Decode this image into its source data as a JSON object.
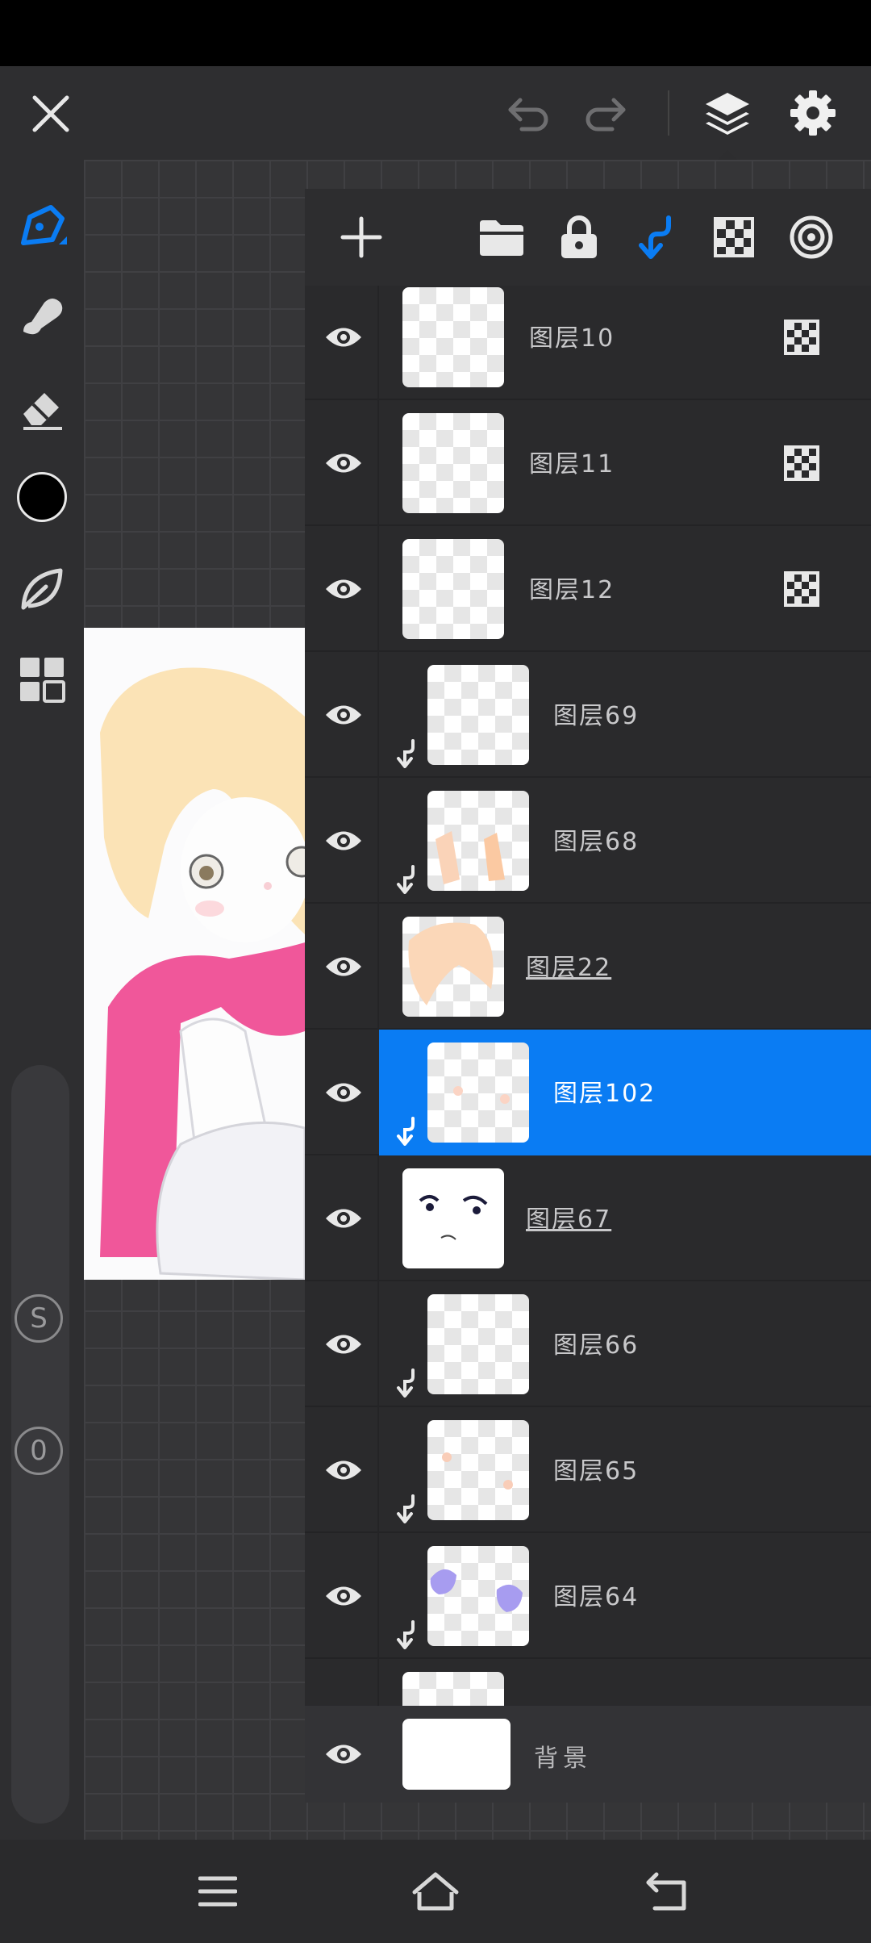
{
  "colors": {
    "accent": "#0a7cf3",
    "current_color": "#000000",
    "panel_bg": "#2a2a2c"
  },
  "topbar": {
    "close_icon": "close-icon",
    "undo_icon": "undo-icon",
    "redo_icon": "redo-icon",
    "layers_icon": "layers-icon",
    "settings_icon": "gear-icon"
  },
  "toolbar": {
    "tools": [
      "brush-tool",
      "smudge-tool",
      "eraser-tool",
      "color-swatch",
      "leaf-tool",
      "grid-tool"
    ],
    "size_label": "S",
    "opacity_label": "0"
  },
  "layer_panel": {
    "header_icons": [
      "add-layer-icon",
      "folder-icon",
      "lock-icon",
      "clip-icon",
      "alpha-lock-icon",
      "blend-icon"
    ],
    "layers": [
      {
        "name": "图层10",
        "clipped": false,
        "alpha_locked": true,
        "underlined": false,
        "selected": false
      },
      {
        "name": "图层11",
        "clipped": false,
        "alpha_locked": true,
        "underlined": false,
        "selected": false
      },
      {
        "name": "图层12",
        "clipped": false,
        "alpha_locked": true,
        "underlined": false,
        "selected": false
      },
      {
        "name": "图层69",
        "clipped": true,
        "alpha_locked": false,
        "underlined": false,
        "selected": false
      },
      {
        "name": "图层68",
        "clipped": true,
        "alpha_locked": false,
        "underlined": false,
        "selected": false
      },
      {
        "name": "图层22",
        "clipped": false,
        "alpha_locked": false,
        "underlined": true,
        "selected": false
      },
      {
        "name": "图层102",
        "clipped": true,
        "alpha_locked": false,
        "underlined": false,
        "selected": true
      },
      {
        "name": "图层67",
        "clipped": false,
        "alpha_locked": false,
        "underlined": true,
        "selected": false
      },
      {
        "name": "图层66",
        "clipped": true,
        "alpha_locked": false,
        "underlined": false,
        "selected": false
      },
      {
        "name": "图层65",
        "clipped": true,
        "alpha_locked": false,
        "underlined": false,
        "selected": false
      },
      {
        "name": "图层64",
        "clipped": true,
        "alpha_locked": false,
        "underlined": false,
        "selected": false
      }
    ],
    "background_layer": {
      "name": "背景"
    }
  },
  "navbar": {
    "menu_icon": "menu-icon",
    "home_icon": "home-icon",
    "back_icon": "back-icon"
  }
}
